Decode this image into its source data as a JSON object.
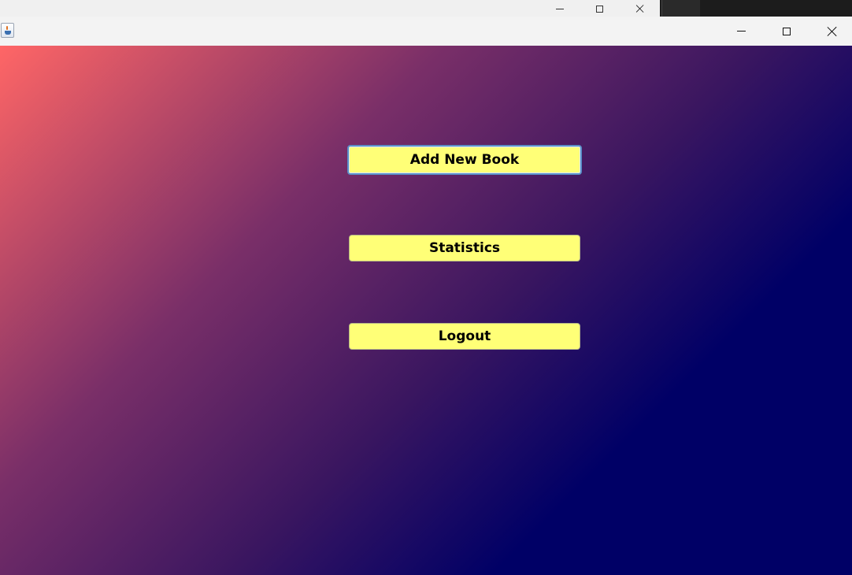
{
  "background_window": {
    "controls": [
      "minimize-icon",
      "maximize-icon",
      "close-icon"
    ]
  },
  "window": {
    "title": "",
    "icon": "java-cup-icon",
    "controls": [
      "minimize-icon",
      "maximize-icon",
      "close-icon"
    ]
  },
  "menu": {
    "add_book_label": "Add New Book",
    "statistics_label": "Statistics",
    "logout_label": "Logout"
  },
  "colors": {
    "gradient_start": "#ff6666",
    "gradient_end": "#000066",
    "button_background": "#ffff77",
    "focus_ring": "#5b8fc7"
  }
}
